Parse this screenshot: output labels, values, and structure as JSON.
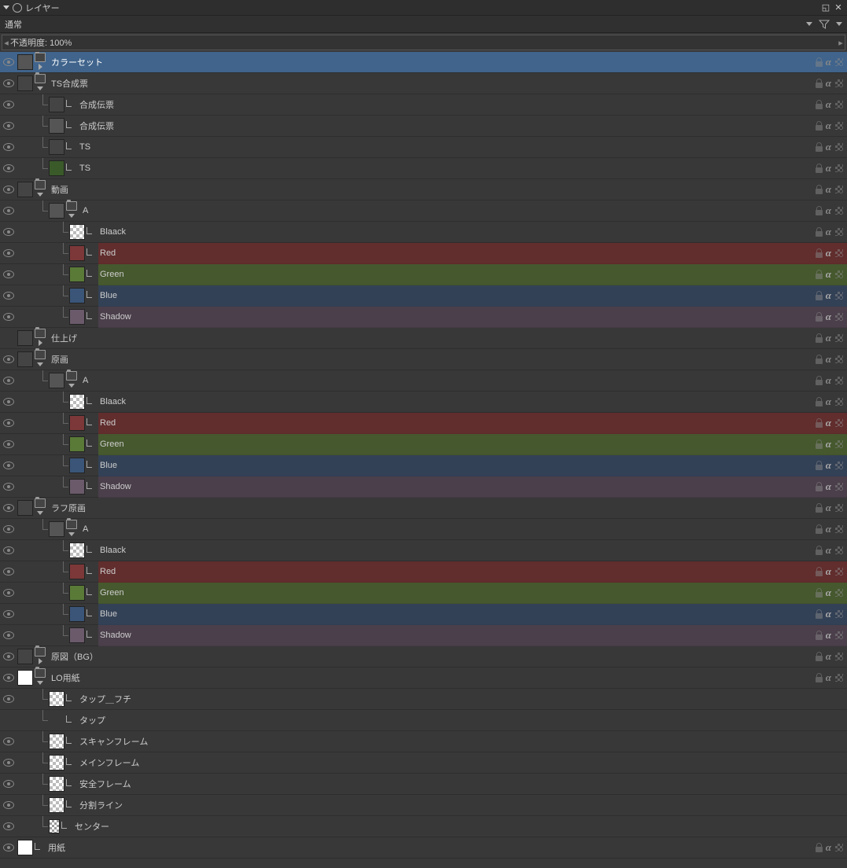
{
  "panel": {
    "title": "レイヤー"
  },
  "mode": {
    "label": "通常"
  },
  "opacity": {
    "label": "不透明度: 100%"
  },
  "rows": [
    {
      "indent": 0,
      "vis": true,
      "sel": true,
      "thumb": "gray",
      "folder": true,
      "expand": "right",
      "name": "カラーセット",
      "icons": [
        "lock",
        "alpha",
        "px"
      ]
    },
    {
      "indent": 0,
      "vis": true,
      "thumb": "dark",
      "folder": true,
      "expand": "down",
      "name": "TS合成票",
      "icons": [
        "lock",
        "alpha",
        "px"
      ]
    },
    {
      "indent": 1,
      "vis": true,
      "tree": true,
      "thumb": "dark",
      "corner": true,
      "name": "合成伝票",
      "icons": [
        "lock",
        "alpha",
        "px"
      ]
    },
    {
      "indent": 1,
      "vis": true,
      "tree": true,
      "thumb": "gray",
      "corner": true,
      "name": "合成伝票",
      "icons": [
        "lock",
        "alpha",
        "px"
      ]
    },
    {
      "indent": 1,
      "vis": true,
      "tree": true,
      "thumb": "dark",
      "corner": true,
      "name": "TS",
      "icons": [
        "lock",
        "alpha",
        "px"
      ]
    },
    {
      "indent": 1,
      "vis": true,
      "tree": true,
      "thumb": "green",
      "corner": true,
      "name": "TS",
      "icons": [
        "lock",
        "alpha",
        "px"
      ]
    },
    {
      "indent": 0,
      "vis": true,
      "thumb": "dark",
      "folder": true,
      "expand": "down",
      "name": "動画",
      "icons": [
        "lock",
        "alpha",
        "px"
      ]
    },
    {
      "indent": 1,
      "vis": true,
      "tree": true,
      "thumb": "gray",
      "folder": true,
      "expand": "down",
      "name": "A",
      "icons": [
        "lock",
        "alpha",
        "px"
      ]
    },
    {
      "indent": 2,
      "vis": true,
      "tree": true,
      "thumb": "checker",
      "corner": true,
      "name": "Blaack",
      "icons": [
        "lock",
        "alpha",
        "px"
      ]
    },
    {
      "indent": 2,
      "vis": true,
      "tree": true,
      "thumb": "colorred",
      "corner": true,
      "name": "Red",
      "colorRow": "cred",
      "icons": [
        "lock",
        "alpha",
        "px"
      ]
    },
    {
      "indent": 2,
      "vis": true,
      "tree": true,
      "thumb": "colorgreen",
      "corner": true,
      "name": "Green",
      "colorRow": "cgreen",
      "icons": [
        "lock",
        "alpha",
        "px"
      ]
    },
    {
      "indent": 2,
      "vis": true,
      "tree": true,
      "thumb": "colorblue",
      "corner": true,
      "name": "Blue",
      "colorRow": "cblue",
      "icons": [
        "lock",
        "alpha",
        "px"
      ]
    },
    {
      "indent": 2,
      "vis": true,
      "tree": true,
      "thumb": "colorshadow",
      "corner": true,
      "name": "Shadow",
      "colorRow": "cshadow",
      "icons": [
        "lock",
        "alpha",
        "px"
      ]
    },
    {
      "indent": 0,
      "vis": false,
      "thumb": "dark",
      "folder": true,
      "expand": "right",
      "name": "仕上げ",
      "icons": [
        "lock",
        "alpha",
        "px"
      ]
    },
    {
      "indent": 0,
      "vis": true,
      "thumb": "dark",
      "folder": true,
      "expand": "down",
      "name": "原画",
      "icons": [
        "lock",
        "alpha",
        "px"
      ]
    },
    {
      "indent": 1,
      "vis": true,
      "tree": true,
      "thumb": "gray",
      "folder": true,
      "expand": "down",
      "name": "A",
      "icons": [
        "lock",
        "alpha",
        "px"
      ]
    },
    {
      "indent": 2,
      "vis": true,
      "tree": true,
      "thumb": "checker",
      "corner": true,
      "name": "Blaack",
      "icons": [
        "lock",
        "alpha",
        "px"
      ]
    },
    {
      "indent": 2,
      "vis": true,
      "tree": true,
      "thumb": "colorred",
      "corner": true,
      "name": "Red",
      "colorRow": "cred",
      "icons": [
        "lock",
        "alpha",
        "px"
      ]
    },
    {
      "indent": 2,
      "vis": true,
      "tree": true,
      "thumb": "colorgreen",
      "corner": true,
      "name": "Green",
      "colorRow": "cgreen",
      "icons": [
        "lock",
        "alpha",
        "px"
      ]
    },
    {
      "indent": 2,
      "vis": true,
      "tree": true,
      "thumb": "colorblue",
      "corner": true,
      "name": "Blue",
      "colorRow": "cblue",
      "icons": [
        "lock",
        "alpha",
        "px"
      ]
    },
    {
      "indent": 2,
      "vis": true,
      "tree": true,
      "thumb": "colorshadow",
      "corner": true,
      "name": "Shadow",
      "colorRow": "cshadow",
      "icons": [
        "lock",
        "alpha",
        "px"
      ]
    },
    {
      "indent": 0,
      "vis": true,
      "thumb": "dark",
      "folder": true,
      "expand": "down",
      "name": "ラフ原画",
      "icons": [
        "lock",
        "alpha",
        "px"
      ]
    },
    {
      "indent": 1,
      "vis": true,
      "tree": true,
      "thumb": "gray",
      "folder": true,
      "expand": "down",
      "name": "A",
      "icons": [
        "lock",
        "alpha",
        "px"
      ]
    },
    {
      "indent": 2,
      "vis": true,
      "tree": true,
      "thumb": "checker",
      "corner": true,
      "name": "Blaack",
      "icons": [
        "lock",
        "alpha",
        "px"
      ]
    },
    {
      "indent": 2,
      "vis": true,
      "tree": true,
      "thumb": "colorred",
      "corner": true,
      "name": "Red",
      "colorRow": "cred",
      "icons": [
        "lock",
        "alpha",
        "px"
      ]
    },
    {
      "indent": 2,
      "vis": true,
      "tree": true,
      "thumb": "colorgreen",
      "corner": true,
      "name": "Green",
      "colorRow": "cgreen",
      "icons": [
        "lock",
        "alpha",
        "px"
      ]
    },
    {
      "indent": 2,
      "vis": true,
      "tree": true,
      "thumb": "colorblue",
      "corner": true,
      "name": "Blue",
      "colorRow": "cblue",
      "icons": [
        "lock",
        "alpha",
        "px"
      ]
    },
    {
      "indent": 2,
      "vis": true,
      "tree": true,
      "thumb": "colorshadow",
      "corner": true,
      "name": "Shadow",
      "colorRow": "cshadow",
      "icons": [
        "lock",
        "alpha",
        "px"
      ]
    },
    {
      "indent": 0,
      "vis": true,
      "thumb": "dark",
      "folder": true,
      "expand": "right",
      "name": "原図（BG）",
      "icons": [
        "lock",
        "alpha",
        "px"
      ]
    },
    {
      "indent": 0,
      "vis": true,
      "thumb": "white",
      "folder": true,
      "expand": "down",
      "name": "LO用紙",
      "icons": [
        "lock",
        "alpha",
        "px"
      ]
    },
    {
      "indent": 1,
      "vis": true,
      "tree": true,
      "thumb": "checker",
      "corner": true,
      "name": "タップ＿フチ",
      "icons": []
    },
    {
      "indent": 1,
      "vis": false,
      "tree": true,
      "nothumb": true,
      "corner": true,
      "name": "タップ",
      "icons": []
    },
    {
      "indent": 1,
      "vis": true,
      "tree": true,
      "thumb": "checker",
      "corner": true,
      "name": "スキャンフレーム",
      "icons": []
    },
    {
      "indent": 1,
      "vis": true,
      "tree": true,
      "thumb": "checker",
      "corner": true,
      "name": "メインフレーム",
      "icons": []
    },
    {
      "indent": 1,
      "vis": true,
      "tree": true,
      "thumb": "checker",
      "corner": true,
      "name": "安全フレーム",
      "icons": []
    },
    {
      "indent": 1,
      "vis": true,
      "tree": true,
      "thumb": "checker",
      "corner": true,
      "name": "分割ライン",
      "icons": []
    },
    {
      "indent": 1,
      "vis": true,
      "tree": true,
      "thumb": "smallchecker",
      "corner": true,
      "name": "センター",
      "icons": []
    },
    {
      "indent": 0,
      "vis": true,
      "thumb": "white",
      "corner": true,
      "name": "用紙",
      "icons": [
        "lock",
        "alpha",
        "px"
      ]
    }
  ]
}
